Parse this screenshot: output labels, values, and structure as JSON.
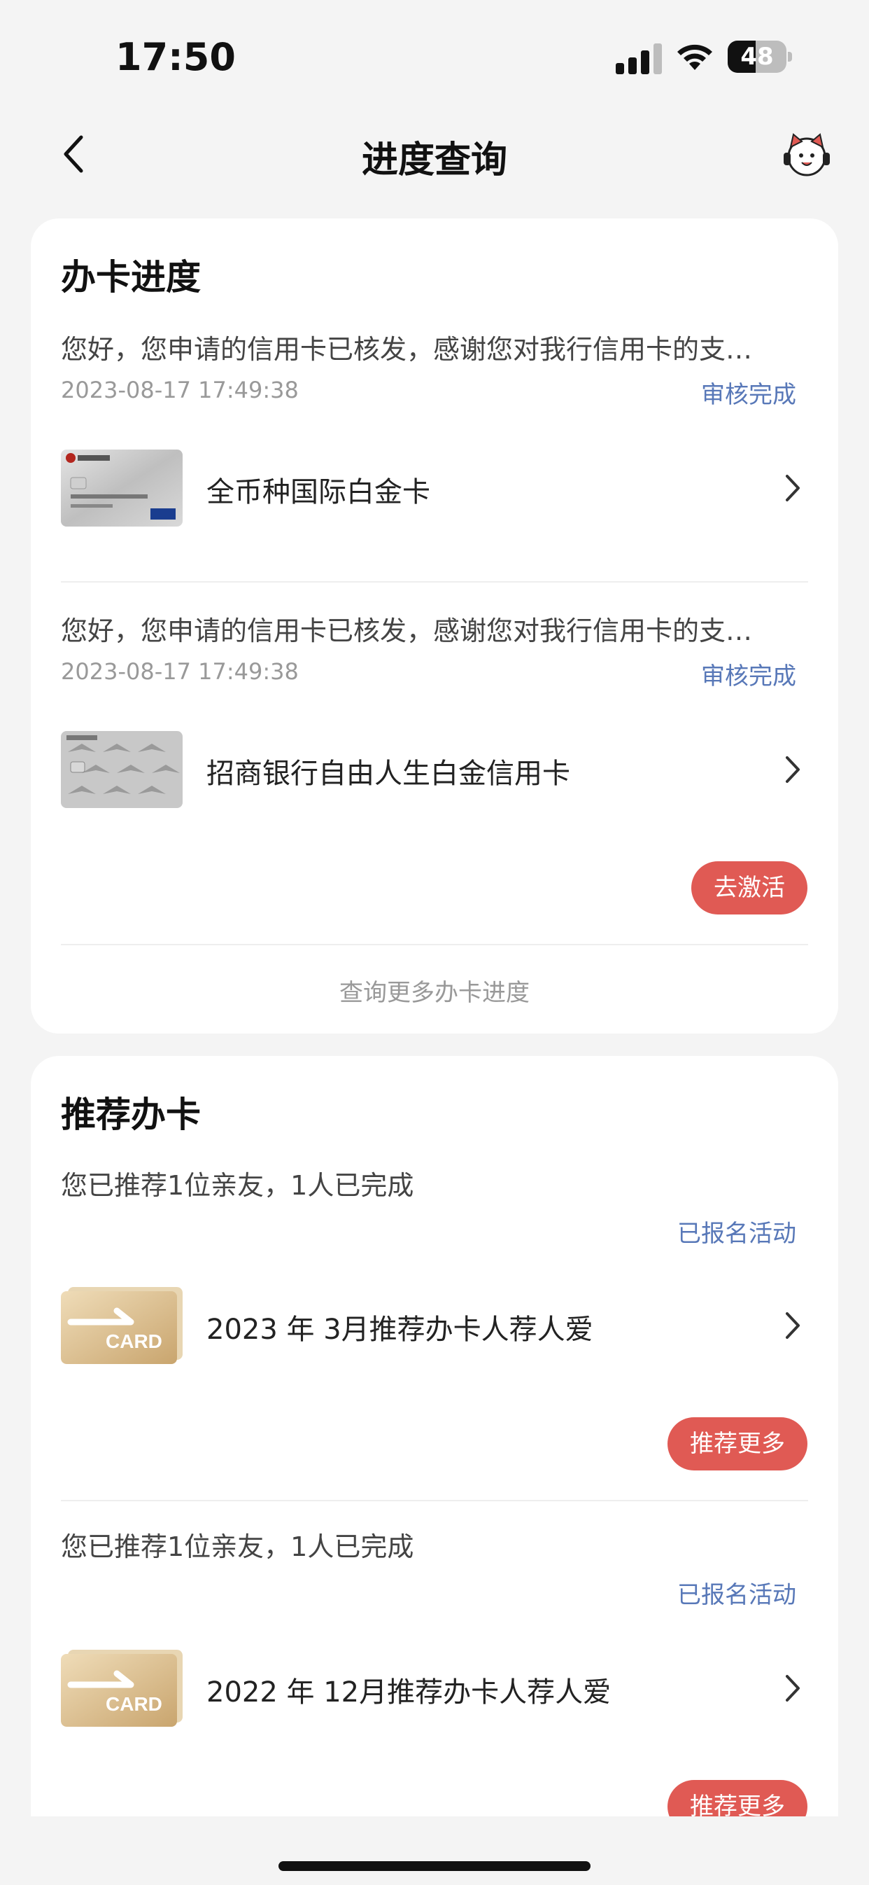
{
  "status_bar": {
    "time": "17:50",
    "battery": "48",
    "battery_level": 0.48
  },
  "nav": {
    "title": "进度查询"
  },
  "progress_section": {
    "title": "办卡进度",
    "items": [
      {
        "message": "您好，您申请的信用卡已核发，感谢您对我行信用卡的支…",
        "date": "2023-08-17 17:49:38",
        "status": "审核完成",
        "card_name": "全币种国际白金卡"
      },
      {
        "message": "您好，您申请的信用卡已核发，感谢您对我行信用卡的支…",
        "date": "2023-08-17 17:49:38",
        "status": "审核完成",
        "card_name": "招商银行自由人生白金信用卡",
        "action": "去激活"
      }
    ],
    "more_link": "查询更多办卡进度"
  },
  "recommend_section": {
    "title": "推荐办卡",
    "items": [
      {
        "summary": "您已推荐1位亲友，1人已完成",
        "status": "已报名活动",
        "activity_name": "2023 年 3月推荐办卡人荐人爱",
        "thumb_text": "CARD",
        "action": "推荐更多"
      },
      {
        "summary": "您已推荐1位亲友，1人已完成",
        "status": "已报名活动",
        "activity_name": "2022 年 12月推荐办卡人荐人爱",
        "thumb_text": "CARD",
        "action": "推荐更多"
      }
    ]
  },
  "colors": {
    "accent_red": "#e05a54",
    "link_blue": "#5878b8",
    "background": "#f4f4f4"
  }
}
